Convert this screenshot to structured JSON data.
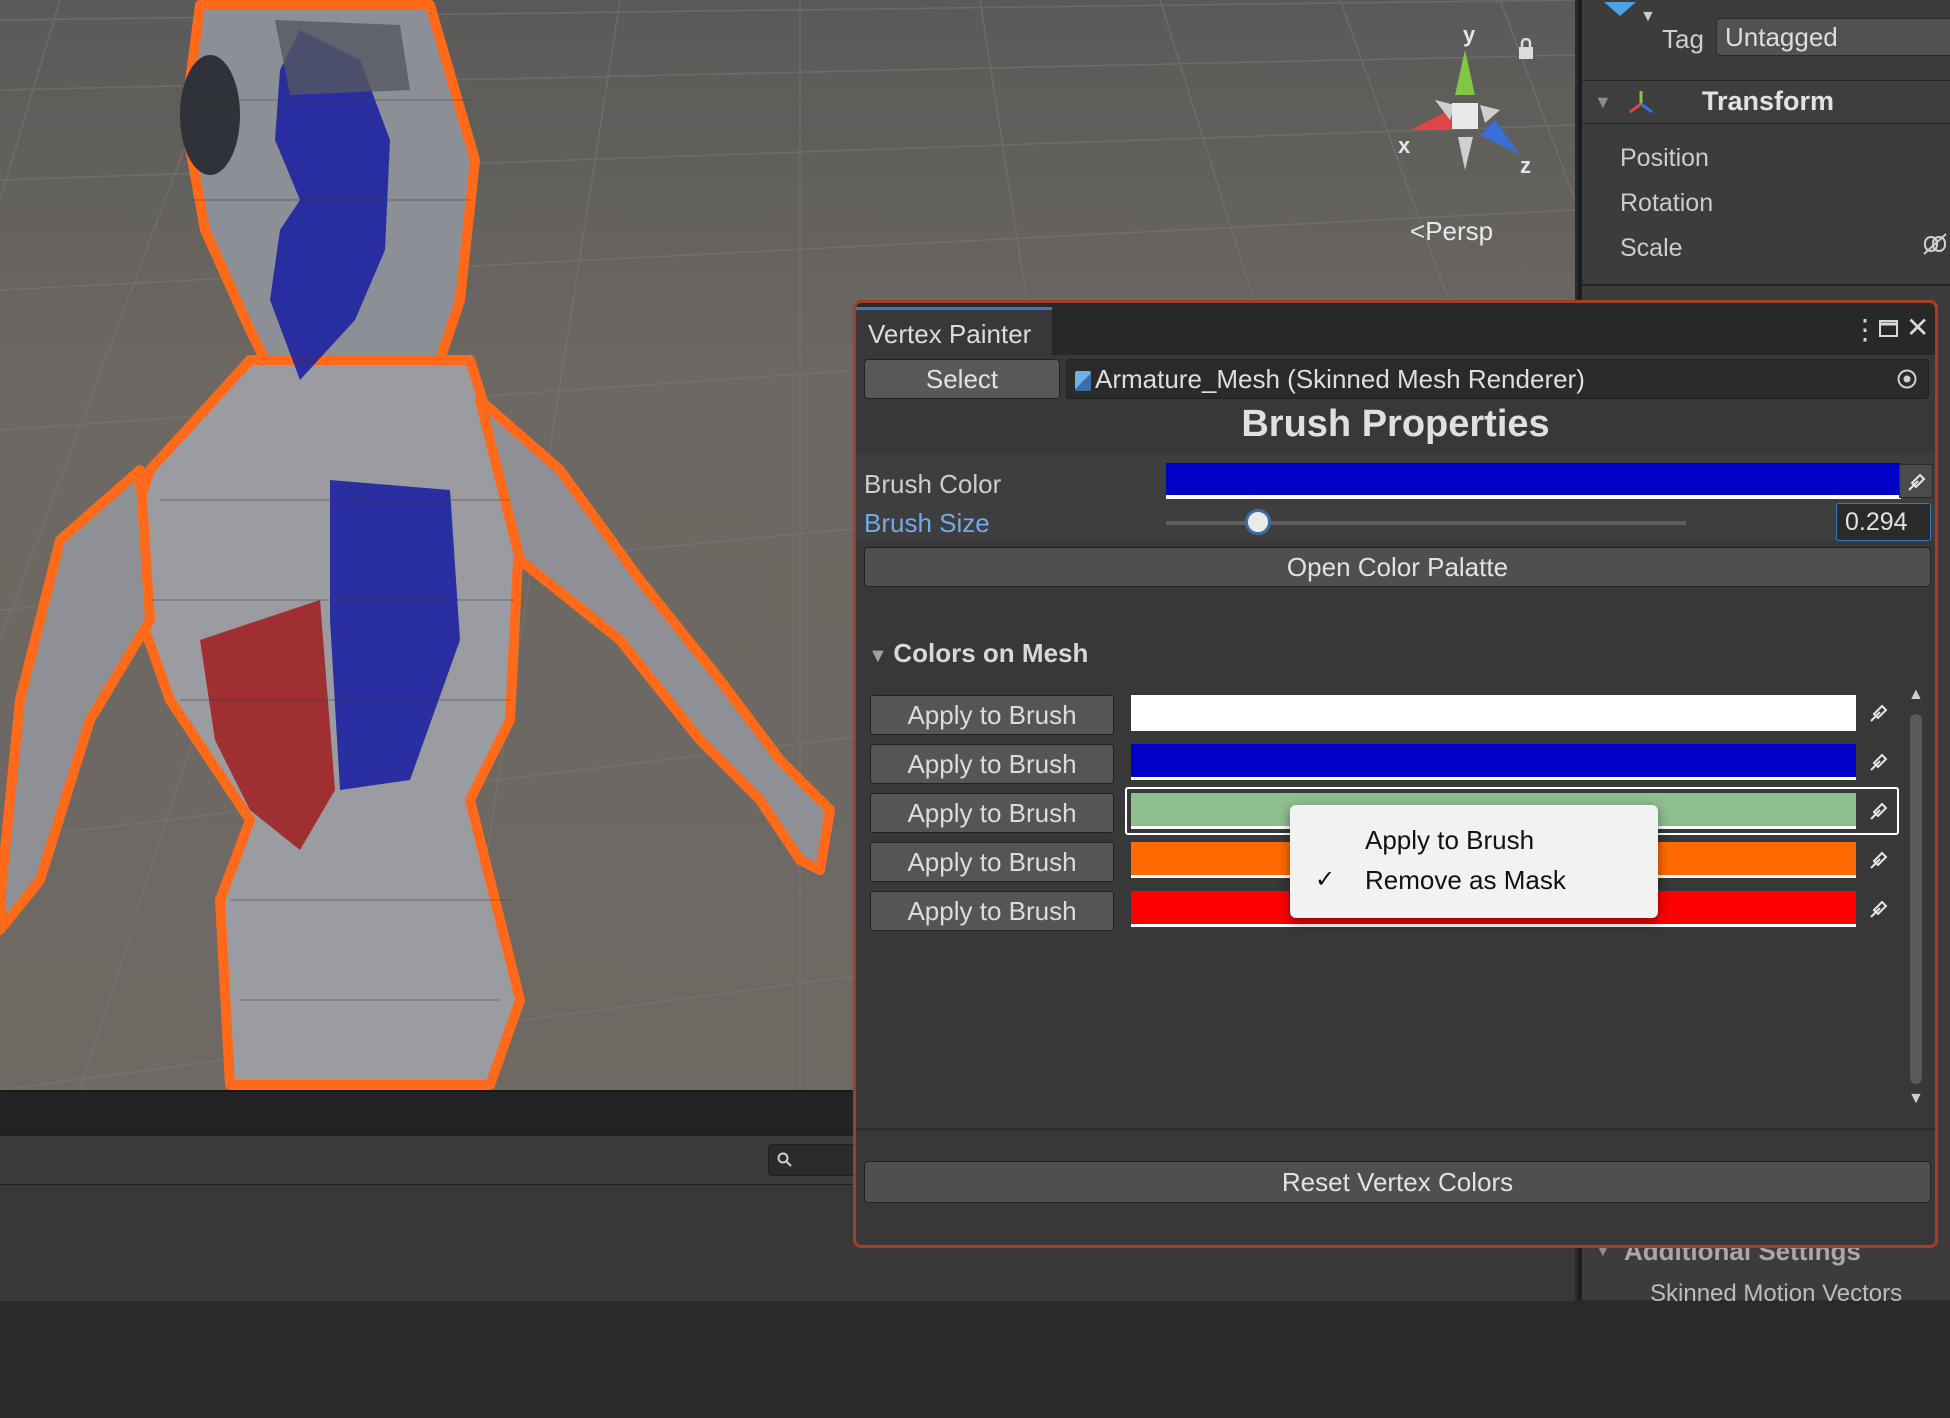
{
  "scene": {
    "gizmo": {
      "y_label": "y",
      "x_label": "x",
      "z_label": "z"
    },
    "projection": "Persp",
    "icons": [
      "lock-icon",
      "search-icon"
    ]
  },
  "inspector": {
    "tag_label": "Tag",
    "tag_value": "Untagged",
    "transform_title": "Transform",
    "props": [
      "Position",
      "Rotation",
      "Scale"
    ],
    "additional_settings": "Additional Settings",
    "skinned_motion": "Skinned Motion Vectors"
  },
  "vertex_painter": {
    "tab_title": "Vertex Painter",
    "select_label": "Select",
    "target_object": "Armature_Mesh (Skinned Mesh Renderer)",
    "section_title": "Brush Properties",
    "brush_color_label": "Brush Color",
    "brush_color": "#0000c8",
    "brush_size_label": "Brush Size",
    "brush_size_value": "0.294",
    "open_palette_label": "Open Color Palatte",
    "colors_foldout": "Colors on Mesh",
    "colors": [
      {
        "button": "Apply to Brush",
        "color": "#ffffff"
      },
      {
        "button": "Apply to Brush",
        "color": "#0000c8"
      },
      {
        "button": "Apply to Brush",
        "color": "#8fbf8f"
      },
      {
        "button": "Apply to Brush",
        "color": "#ff6a00"
      },
      {
        "button": "Apply to Brush",
        "color": "#ff0000"
      }
    ],
    "reset_label": "Reset Vertex Colors"
  },
  "context_menu": {
    "items": [
      "Apply to Brush",
      "Remove as Mask"
    ],
    "checked_item": "Remove as Mask"
  }
}
